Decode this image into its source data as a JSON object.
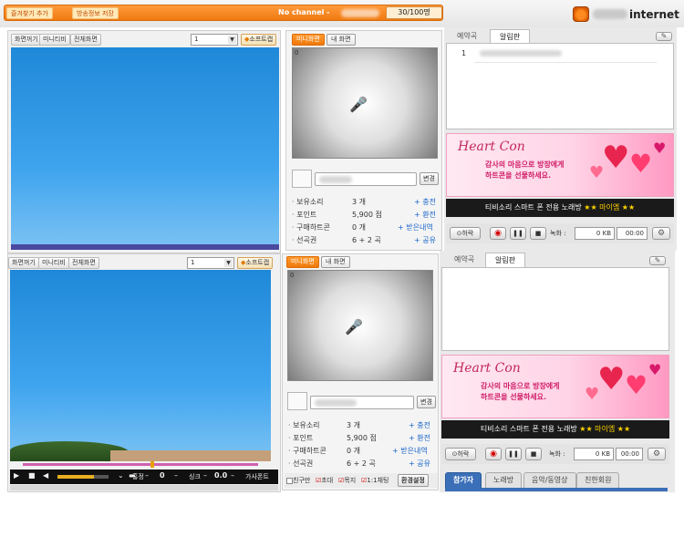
{
  "topbar": {
    "favorites_label": "즐겨찾기 추가",
    "broadcast_label": "방송정보 저장",
    "channel_text": "No channel - ",
    "viewer_count": "30/100명",
    "logo_text": "internet"
  },
  "left_top": {
    "buttons": [
      "화면꺼기",
      "미니티비",
      "전체화면"
    ],
    "select_value": "1",
    "soft_label": "소프트캡"
  },
  "left_bottom": {
    "buttons": [
      "화면꺼기",
      "미니티비",
      "전체화면"
    ],
    "select_value": "1",
    "soft_label": "소프트캡"
  },
  "player": {
    "sync_label": "홍정",
    "sync_value": "0",
    "sink_label": "싱크",
    "sink_value": "0.0",
    "lyrics_label": "가사폰트"
  },
  "mid_top": {
    "tab_mini": "미니화면",
    "tab_mine": "내 화면",
    "video_index": "0",
    "change_label": "변경",
    "info": [
      {
        "label": "보유소리",
        "value": "3 개",
        "link": "+ 충전"
      },
      {
        "label": "포인트",
        "value": "5,900 점",
        "link": "+ 환전"
      },
      {
        "label": "구매하트콘",
        "value": "0 개",
        "link": "+ 받은내역"
      },
      {
        "label": "선곡권",
        "value": "6 + 2 곡",
        "link": "+ 공유"
      }
    ]
  },
  "mid_bottom": {
    "tab_mini": "미니화면",
    "tab_mine": "내 화면",
    "video_index": "0",
    "change_label": "변경",
    "info": [
      {
        "label": "보유소리",
        "value": "3 개",
        "link": "+ 충전"
      },
      {
        "label": "포인트",
        "value": "5,900 점",
        "link": "+ 환전"
      },
      {
        "label": "구매하트콘",
        "value": "0 개",
        "link": "+ 받은내역"
      },
      {
        "label": "선곡권",
        "value": "6 + 2 곡",
        "link": "+ 공유"
      }
    ],
    "checks": [
      "친구만",
      "초대",
      "목지",
      "1:1채팅"
    ],
    "settings_label": "환경설정"
  },
  "right_top": {
    "tab_reserve": "예약곡",
    "tab_board": "알림판",
    "list_first": "1",
    "banner_brand": "Heart Con",
    "banner_line1": "감사의 마음으로 방장에게",
    "banner_line2": "하트콘을 선물하세요.",
    "black_bar": "티비소리 스마트 폰 전용 노래방",
    "black_bar_star": "★★",
    "black_bar_app": "마이엠",
    "record_label": "녹화 :",
    "kb_value": "0 KB",
    "time_value": "00:00",
    "invite_label": "허락"
  },
  "right_bottom": {
    "tab_reserve": "예약곡",
    "tab_board": "알림판",
    "banner_brand": "Heart Con",
    "banner_line1": "감사의 마음으로 방장에게",
    "banner_line2": "하트콘을 선물하세요.",
    "black_bar": "티비소리 스마트 폰 전용 노래방",
    "black_bar_star": "★★",
    "black_bar_app": "마이엠",
    "record_label": "녹화 :",
    "kb_value": "0 KB",
    "time_value": "00:00",
    "invite_label": "허락"
  },
  "bottom_tabs": [
    "참가자",
    "노래방",
    "음악/동영상",
    "친한회원"
  ],
  "colors": {
    "accent_orange": "#f07a10",
    "sky_blue": "#3fa4ee",
    "link_blue": "#1663c7",
    "tab_blue": "#3b6fb8"
  }
}
